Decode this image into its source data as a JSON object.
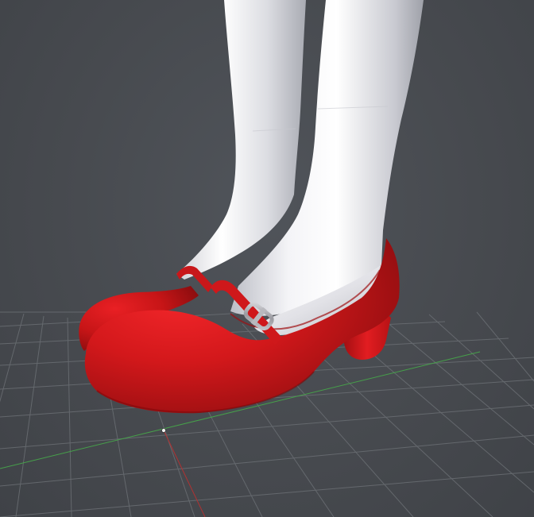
{
  "viewport": {
    "background_color": "#474a4f",
    "grid_color": "#6a6e73",
    "x_axis_color": "#46a04a",
    "z_axis_color": "#b03232",
    "pivot_color": "#f2f2f2"
  },
  "model": {
    "skin_color": "#e6e6ea",
    "shoe_color": "#d8191a",
    "shoe_shadow_color": "#8f0e0f",
    "buckle_color": "#a9a9ad"
  }
}
